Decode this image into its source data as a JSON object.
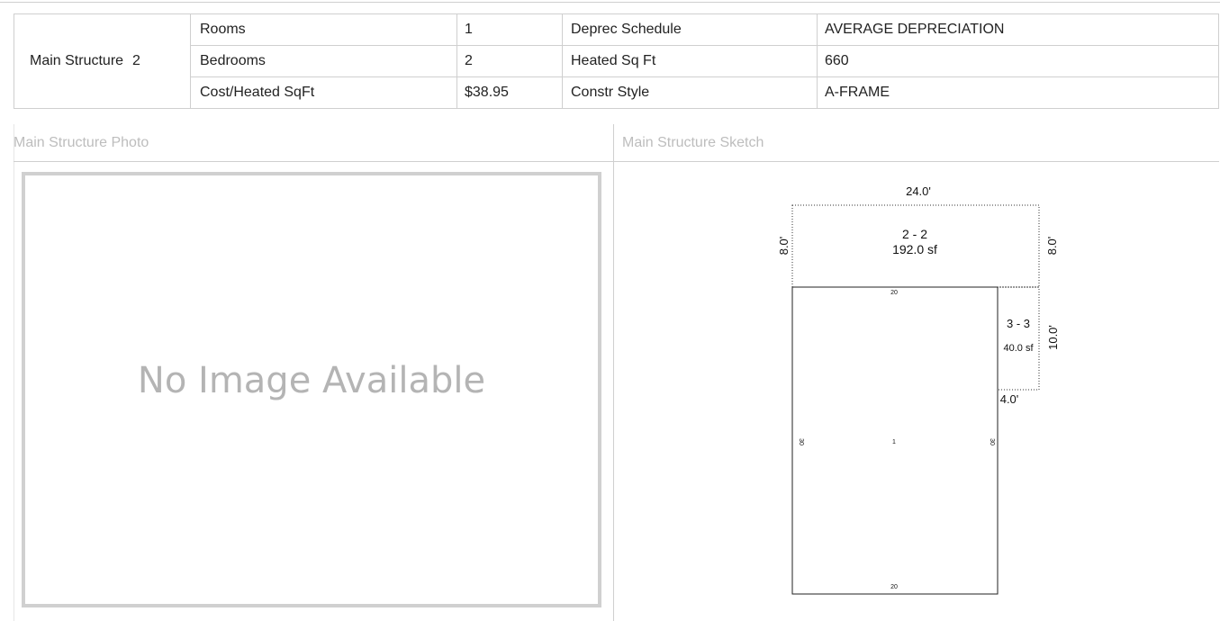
{
  "structure": {
    "name": "Main Structure",
    "number": "2",
    "rows": [
      {
        "label": "Rooms",
        "value": "1",
        "label2": "Deprec Schedule",
        "value2": "AVERAGE DEPRECIATION"
      },
      {
        "label": "Bedrooms",
        "value": "2",
        "label2": "Heated Sq Ft",
        "value2": "660"
      },
      {
        "label": "Cost/Heated SqFt",
        "value": "$38.95",
        "label2": "Constr Style",
        "value2": "A-FRAME"
      }
    ]
  },
  "photo": {
    "header": "Main Structure Photo",
    "placeholder": "No Image Available"
  },
  "sketch": {
    "header": "Main Structure Sketch",
    "top_dim": "24.0'",
    "left_dim": "8.0'",
    "right_dim": "8.0'",
    "area_2_label": "2 - 2",
    "area_2_size": "192.0 sf",
    "area_3_label": "3 - 3",
    "area_3_size": "40.0 sf",
    "area_3_height": "10.0'",
    "area_3_width": "4.0'",
    "area_1_top": "20",
    "area_1_left": "30",
    "area_1_center": "1",
    "area_1_right": "30",
    "area_1_bottom": "20"
  },
  "colors": {
    "border": "#cfcfcf",
    "header_text": "#bdbdbd",
    "placeholder_text": "#b4b4b4"
  }
}
